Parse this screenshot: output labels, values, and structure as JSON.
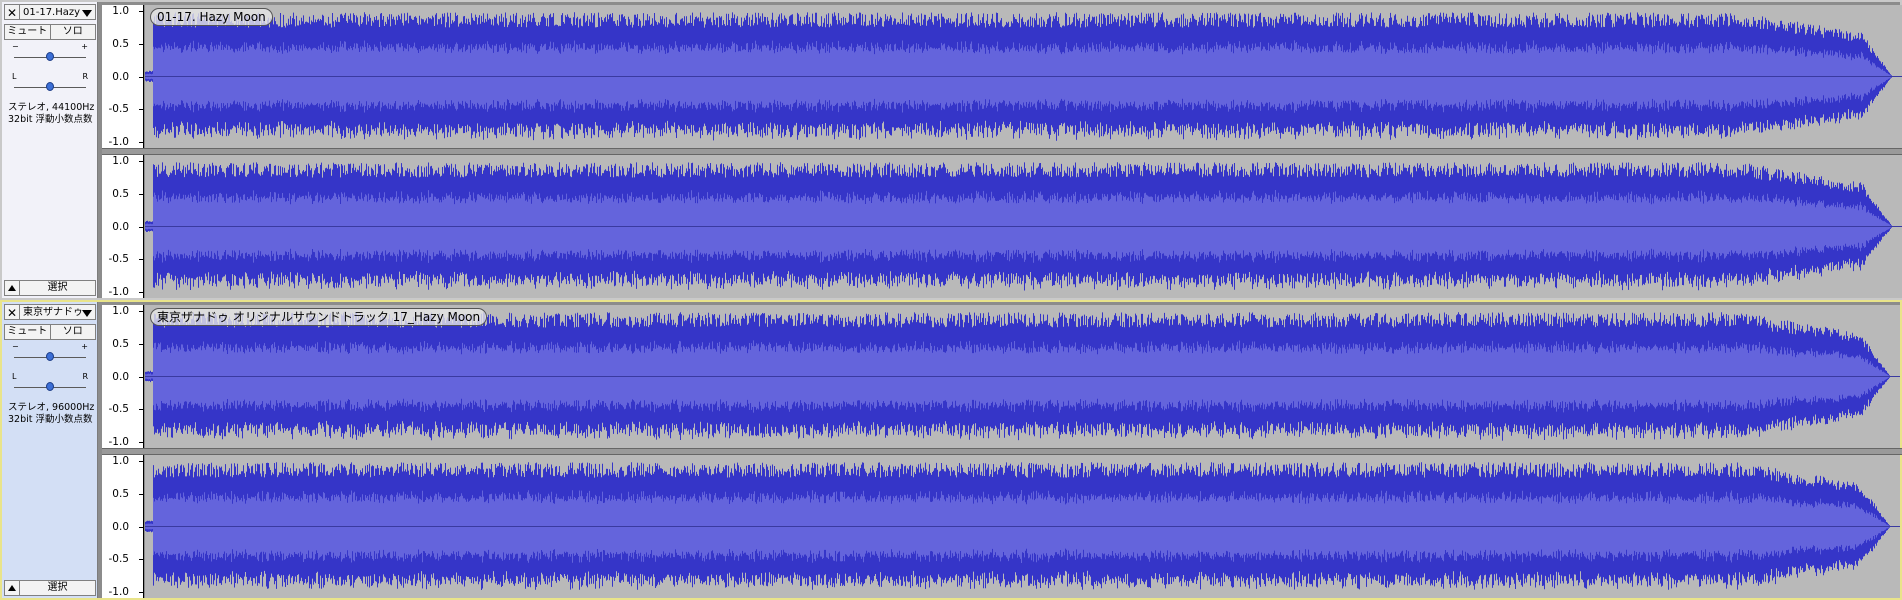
{
  "colors": {
    "wave_peak": "#3535c8",
    "wave_rms": "#6464dc",
    "background": "#b9b9b9",
    "selected_border": "#e9e48a"
  },
  "tracks": [
    {
      "name_short": "01-17.Hazy",
      "clip_name": "01-17. Hazy Moon",
      "mute_label": "ミュート",
      "solo_label": "ソロ",
      "gain_minus": "−",
      "gain_plus": "+",
      "pan_left": "L",
      "pan_right": "R",
      "gain_level": 0.5,
      "pan_level": 0.5,
      "info_line1": "ステレオ, 44100Hz",
      "info_line2": "32bit 浮動小数点数",
      "select_label": "選択",
      "selected": false,
      "close_icon": "close-icon",
      "menu_icon": "dropdown-triangle-icon"
    },
    {
      "name_short": "東京ザナドゥ",
      "clip_name": "東京ザナドゥ オリジナルサウンドトラック 17_Hazy Moon",
      "mute_label": "ミュート",
      "solo_label": "ソロ",
      "gain_minus": "−",
      "gain_plus": "+",
      "pan_left": "L",
      "pan_right": "R",
      "gain_level": 0.5,
      "pan_level": 0.5,
      "info_line1": "ステレオ, 96000Hz",
      "info_line2": "32bit 浮動小数点数",
      "select_label": "選択",
      "selected": true,
      "close_icon": "close-icon",
      "menu_icon": "dropdown-triangle-icon"
    }
  ],
  "amplitude_ticks": [
    "1.0",
    "0.5",
    "0.0",
    "-0.5",
    "-1.0"
  ]
}
